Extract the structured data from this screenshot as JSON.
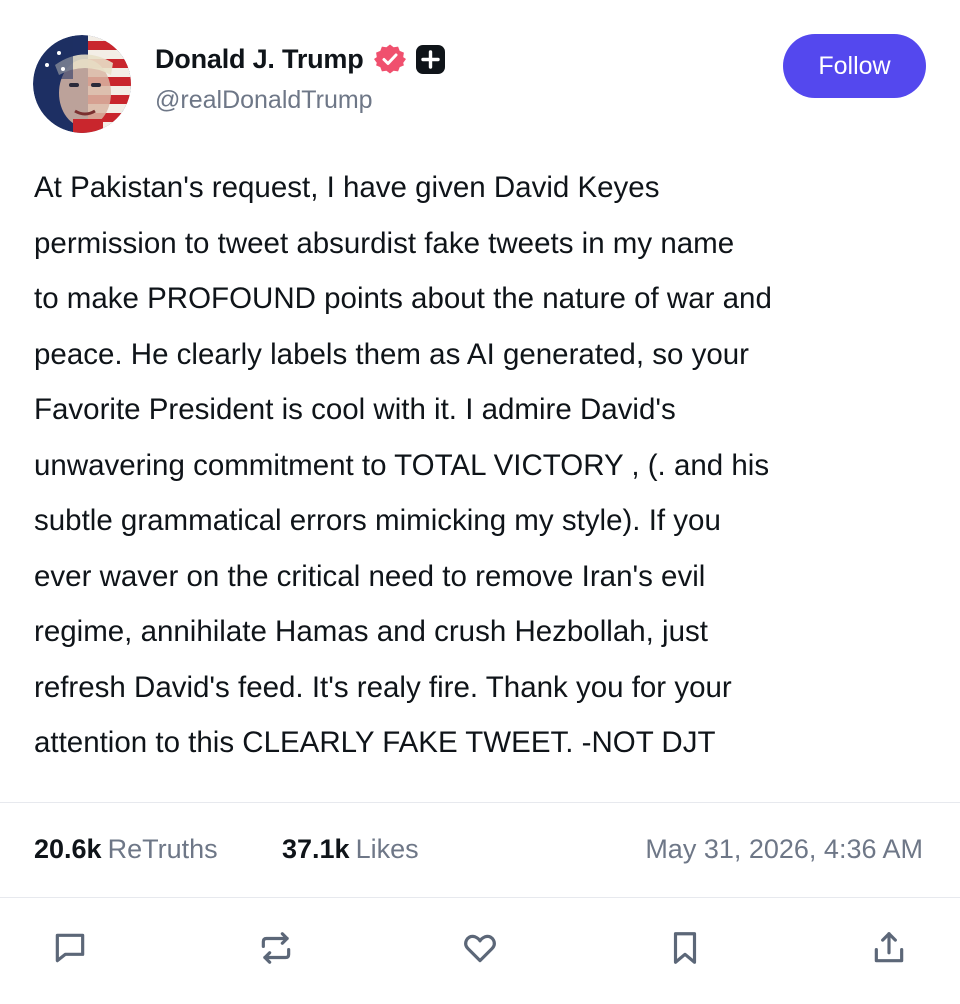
{
  "author": {
    "display_name": "Donald J. Trump",
    "handle": "@realDonaldTrump",
    "avatar": "avatar-flag-portrait",
    "badges": [
      "verified-badge-icon",
      "plus-badge-icon"
    ]
  },
  "follow": {
    "label": "Follow"
  },
  "post": {
    "lines": [
      "At Pakistan's request, I have given David Keyes",
      "permission to tweet absurdist fake tweets in my name",
      "to make PROFOUND points about the nature of war and",
      "peace. He clearly labels them as AI generated, so your",
      "Favorite President is cool with it. I admire David's",
      "unwavering commitment to TOTAL VICTORY , (. and his",
      "subtle grammatical errors mimicking my style). If you",
      "ever waver on the critical need to remove Iran's evil",
      "regime, annihilate Hamas and crush Hezbollah, just",
      "refresh David's feed. It's realy fire. Thank you for your",
      "attention to this CLEARLY FAKE TWEET. -NOT DJT"
    ]
  },
  "stats": {
    "retruths_count": "20.6k",
    "retruths_label": "ReTruths",
    "likes_count": "37.1k",
    "likes_label": "Likes",
    "timestamp": "May 31, 2026, 4:36 AM"
  },
  "actions": [
    {
      "icon": "reply-icon"
    },
    {
      "icon": "retruth-icon"
    },
    {
      "icon": "like-icon"
    },
    {
      "icon": "bookmark-icon"
    },
    {
      "icon": "share-icon"
    }
  ],
  "colors": {
    "accent": "#5448ee",
    "verified": "#f0506e",
    "muted_text": "#6e7787",
    "icon": "#5c6778",
    "divider": "#e7e9ee"
  }
}
